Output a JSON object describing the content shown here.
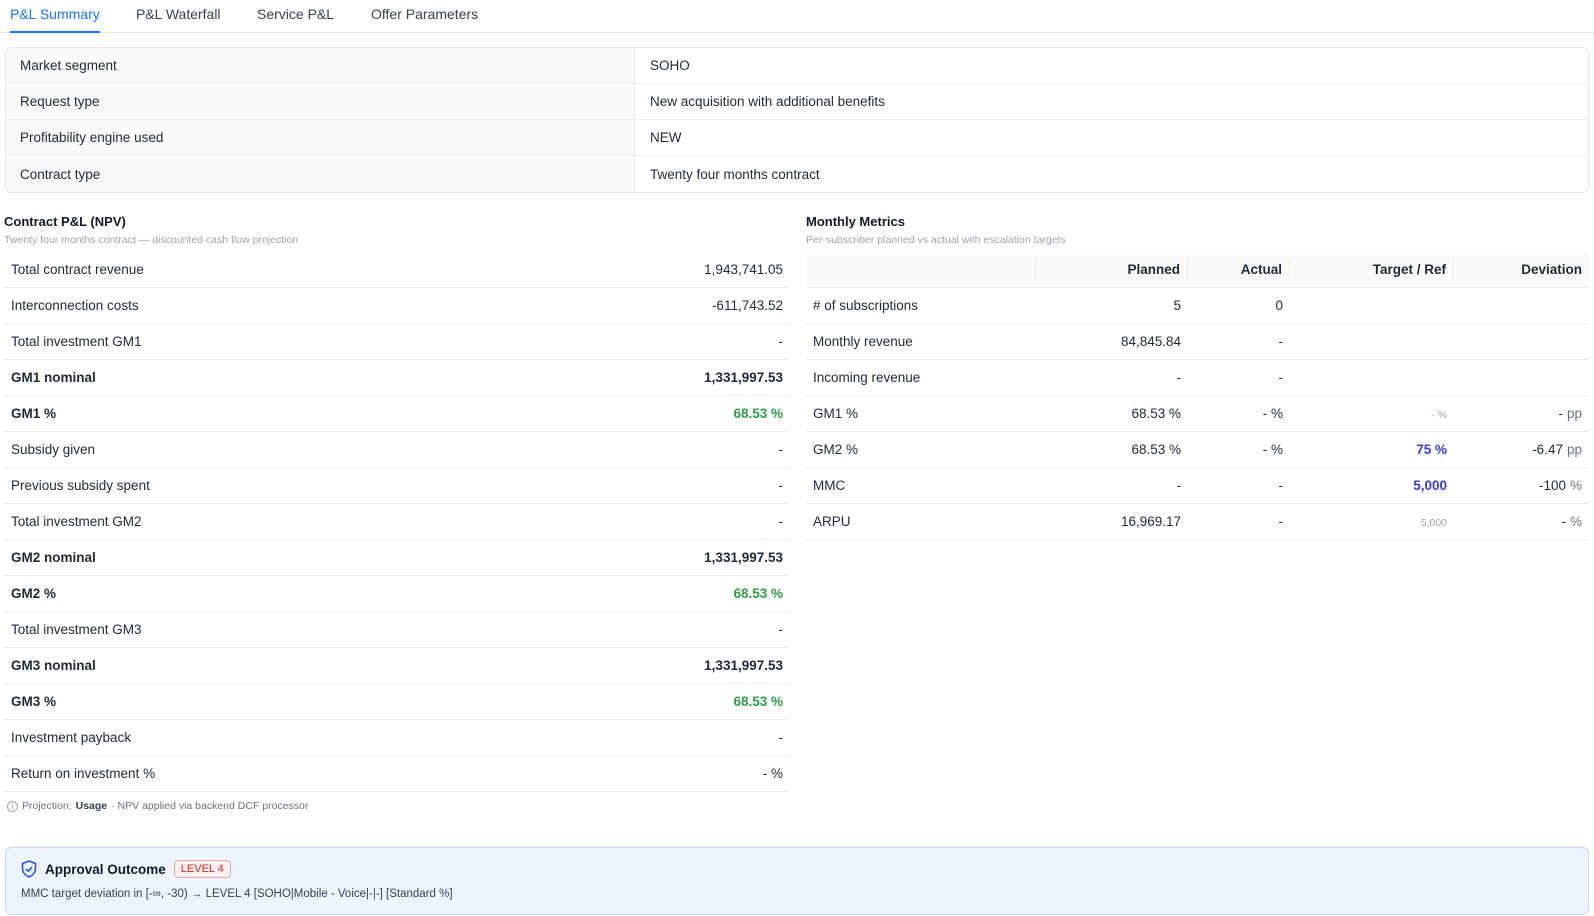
{
  "tabs": [
    {
      "label": "P&L Summary",
      "active": true
    },
    {
      "label": "P&L Waterfall",
      "active": false
    },
    {
      "label": "Service P&L",
      "active": false
    },
    {
      "label": "Offer Parameters",
      "active": false
    }
  ],
  "info": [
    {
      "label": "Market segment",
      "value": "SOHO"
    },
    {
      "label": "Request type",
      "value": "New acquisition with additional benefits"
    },
    {
      "label": "Profitability engine used",
      "value": "NEW"
    },
    {
      "label": "Contract type",
      "value": "Twenty four months contract"
    }
  ],
  "contract_pl": {
    "title": "Contract P&L (NPV)",
    "subtitle": "Twenty four months contract — discounted cash flow projection",
    "rows": [
      {
        "label": "Total contract revenue",
        "value": "1,943,741.05",
        "bold": false,
        "tone": ""
      },
      {
        "label": "Interconnection costs",
        "value": "-611,743.52",
        "bold": false,
        "tone": ""
      },
      {
        "label": "Total investment GM1",
        "value": "-",
        "bold": false,
        "tone": ""
      },
      {
        "label": "GM1 nominal",
        "value": "1,331,997.53",
        "bold": true,
        "tone": ""
      },
      {
        "label": "GM1 %",
        "value": "68.53 %",
        "bold": true,
        "tone": "green"
      },
      {
        "label": "Subsidy given",
        "value": "-",
        "bold": false,
        "tone": ""
      },
      {
        "label": "Previous subsidy spent",
        "value": "-",
        "bold": false,
        "tone": ""
      },
      {
        "label": "Total investment GM2",
        "value": "-",
        "bold": false,
        "tone": ""
      },
      {
        "label": "GM2 nominal",
        "value": "1,331,997.53",
        "bold": true,
        "tone": ""
      },
      {
        "label": "GM2 %",
        "value": "68.53 %",
        "bold": true,
        "tone": "green"
      },
      {
        "label": "Total investment GM3",
        "value": "-",
        "bold": false,
        "tone": ""
      },
      {
        "label": "GM3 nominal",
        "value": "1,331,997.53",
        "bold": true,
        "tone": ""
      },
      {
        "label": "GM3 %",
        "value": "68.53 %",
        "bold": true,
        "tone": "green"
      },
      {
        "label": "Investment payback",
        "value": "-",
        "bold": false,
        "tone": ""
      },
      {
        "label": "Return on investment %",
        "value": "- %",
        "bold": false,
        "tone": ""
      }
    ],
    "footnote": {
      "prefix": "Projection:",
      "mode": "Usage",
      "suffix": "· NPV applied via backend DCF processor"
    }
  },
  "monthly": {
    "title": "Monthly Metrics",
    "subtitle": "Per-subscriber planned vs actual with escalation targets",
    "headers": [
      "",
      "Planned",
      "Actual",
      "Target / Ref",
      "Deviation"
    ],
    "rows": [
      {
        "metric": "# of subscriptions",
        "planned": "5",
        "actual": "0",
        "target": "",
        "target_tone": "",
        "deviation": "",
        "dev_unit": ""
      },
      {
        "metric": "Monthly revenue",
        "planned": "84,845.84",
        "actual": "-",
        "target": "",
        "target_tone": "",
        "deviation": "",
        "dev_unit": ""
      },
      {
        "metric": "Incoming revenue",
        "planned": "-",
        "actual": "-",
        "target": "",
        "target_tone": "",
        "deviation": "",
        "dev_unit": ""
      },
      {
        "metric": "GM1 %",
        "planned": "68.53 %",
        "actual": "- %",
        "target": "- %",
        "target_tone": "tiny",
        "deviation": "-",
        "dev_unit": "pp"
      },
      {
        "metric": "GM2 %",
        "planned": "68.53 %",
        "actual": "- %",
        "target": "75 %",
        "target_tone": "purple",
        "deviation": "-6.47",
        "dev_unit": "pp"
      },
      {
        "metric": "MMC",
        "planned": "-",
        "actual": "-",
        "target": "5,000",
        "target_tone": "purple",
        "deviation": "-100",
        "dev_unit": "%"
      },
      {
        "metric": "ARPU",
        "planned": "16,969.17",
        "actual": "-",
        "target": "5,000",
        "target_tone": "tiny",
        "deviation": "-",
        "dev_unit": "%"
      }
    ]
  },
  "approval": {
    "title": "Approval Outcome",
    "level": "LEVEL 4",
    "description": "MMC target deviation in [-∞, -30) → LEVEL 4 [SOHO|Mobile - Voice|-|-] [Standard %]",
    "icon": "shield-check-icon"
  },
  "colors": {
    "accent": "#1677ff",
    "positive": "#2f9e44",
    "target": "#3b3bd6",
    "danger": "#c92a2a"
  }
}
